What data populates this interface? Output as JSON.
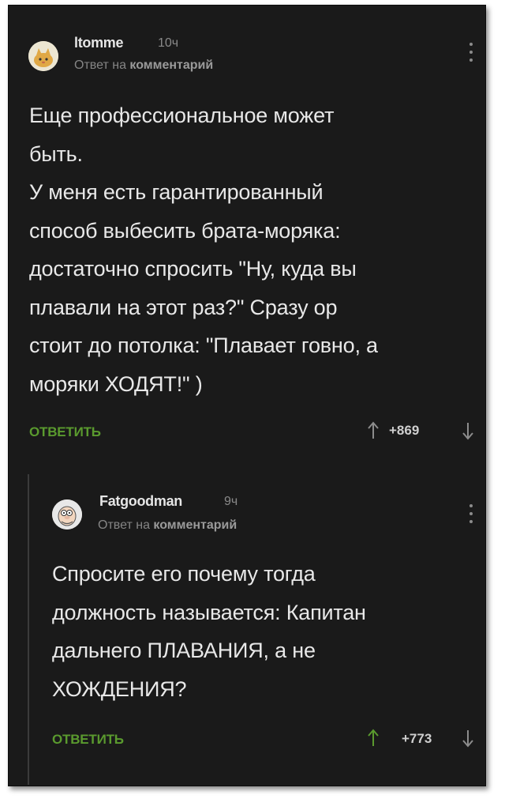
{
  "comments": [
    {
      "author": "ltomme",
      "time": "10ч",
      "reply_prefix": "Ответ на",
      "reply_target": "комментарий",
      "avatar_icon": "cat-avatar-icon",
      "text": "Еще профессиональное может\nбыть.\nУ меня есть гарантированный\nспособ выбесить брата-моряка:\nдостаточно спросить \"Ну, куда вы\nплавали на этот раз?\" Сразу ор\nстоит до потолка: \"Плавает говно, а\nморяки ХОДЯТ!\" )",
      "reply_label": "ОТВЕТИТЬ",
      "rating": "+869",
      "vote_up_color": "#8c8c8c"
    },
    {
      "author": "Fatgoodman",
      "time": "9ч",
      "reply_prefix": "Ответ на",
      "reply_target": "комментарий",
      "avatar_icon": "peter-griffin-avatar-icon",
      "text": "Спросите его почему тогда\nдолжность называется: Капитан\nдальнего ПЛАВАНИЯ, а не\nХОЖДЕНИЯ?",
      "reply_label": "ОТВЕТИТЬ",
      "rating": "+773",
      "vote_up_color": "#5a9a2e"
    }
  ],
  "colors": {
    "background": "#1a1a1a",
    "accent_green": "#5a9a2e",
    "text": "#e8e8e8",
    "muted": "#858585"
  }
}
